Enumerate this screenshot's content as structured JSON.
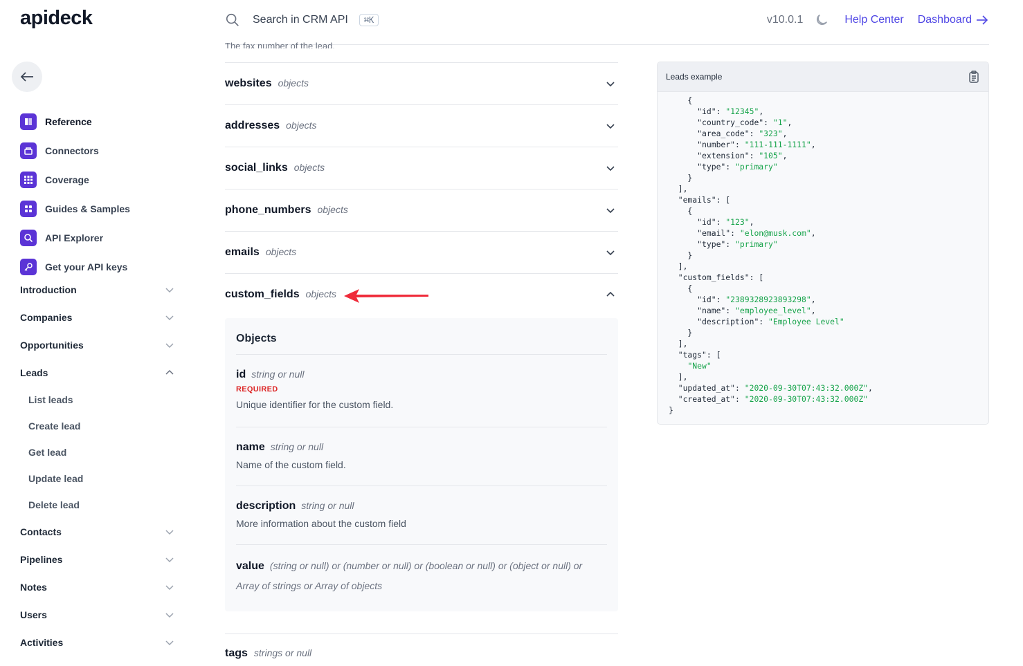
{
  "header": {
    "logo": "apideck",
    "search_label": "Search in CRM API",
    "shortcut": "⌘K",
    "version": "v10.0.1",
    "help_center": "Help Center",
    "dashboard": "Dashboard"
  },
  "sidebar": {
    "top_items": [
      {
        "label": "Reference",
        "icon": "book-icon"
      },
      {
        "label": "Connectors",
        "icon": "connector-icon"
      },
      {
        "label": "Coverage",
        "icon": "grid-icon"
      },
      {
        "label": "Guides & Samples",
        "icon": "apps-icon"
      },
      {
        "label": "API Explorer",
        "icon": "search-icon"
      },
      {
        "label": "Get your API keys",
        "icon": "key-icon"
      }
    ],
    "sections": [
      {
        "label": "Introduction",
        "expanded": false
      },
      {
        "label": "Companies",
        "expanded": false
      },
      {
        "label": "Opportunities",
        "expanded": false
      },
      {
        "label": "Leads",
        "expanded": true
      },
      {
        "label": "Contacts",
        "expanded": false
      },
      {
        "label": "Pipelines",
        "expanded": false
      },
      {
        "label": "Notes",
        "expanded": false
      },
      {
        "label": "Users",
        "expanded": false
      },
      {
        "label": "Activities",
        "expanded": false
      }
    ],
    "leads_sub": [
      "List leads",
      "Create lead",
      "Get lead",
      "Update lead",
      "Delete lead"
    ]
  },
  "main": {
    "fax_text": "The fax number of the lead.",
    "fields": [
      {
        "name": "websites",
        "type": "objects"
      },
      {
        "name": "addresses",
        "type": "objects"
      },
      {
        "name": "social_links",
        "type": "objects"
      },
      {
        "name": "phone_numbers",
        "type": "objects"
      },
      {
        "name": "emails",
        "type": "objects"
      },
      {
        "name": "custom_fields",
        "type": "objects"
      }
    ],
    "objects": {
      "title": "Objects",
      "id": {
        "name": "id",
        "type": "string or null",
        "required": "REQUIRED",
        "desc": "Unique identifier for the custom field."
      },
      "name": {
        "name": "name",
        "type": "string or null",
        "desc": "Name of the custom field."
      },
      "description": {
        "name": "description",
        "type": "string or null",
        "desc": "More information about the custom field"
      },
      "value": {
        "name": "value",
        "type_line1": "(string or null) or (number or null) or (boolean or null) or (object or null) or",
        "type_line2": "Array of strings or Array of objects"
      }
    },
    "tags": {
      "name": "tags",
      "type": "strings or null"
    }
  },
  "example": {
    "title": "Leads example",
    "lines": [
      "    {",
      "      \"id\": \"12345\",",
      "      \"country_code\": \"1\",",
      "      \"area_code\": \"323\",",
      "      \"number\": \"111-111-1111\",",
      "      \"extension\": \"105\",",
      "      \"type\": \"primary\"",
      "    }",
      "  ],",
      "  \"emails\": [",
      "    {",
      "      \"id\": \"123\",",
      "      \"email\": \"elon@musk.com\",",
      "      \"type\": \"primary\"",
      "    }",
      "  ],",
      "  \"custom_fields\": [",
      "    {",
      "      \"id\": \"2389328923893298\",",
      "      \"name\": \"employee_level\",",
      "      \"description\": \"Employee Level\"",
      "    }",
      "  ],",
      "  \"tags\": [",
      "    \"New\"",
      "  ],",
      "  \"updated_at\": \"2020-09-30T07:43:32.000Z\",",
      "  \"created_at\": \"2020-09-30T07:43:32.000Z\"",
      "}"
    ]
  },
  "colors": {
    "accent": "#4f46e5",
    "icon_bg": "#5b34d6",
    "required": "#dc2626",
    "string_value": "#16a34a",
    "annotation_arrow": "#ef2b3a"
  }
}
